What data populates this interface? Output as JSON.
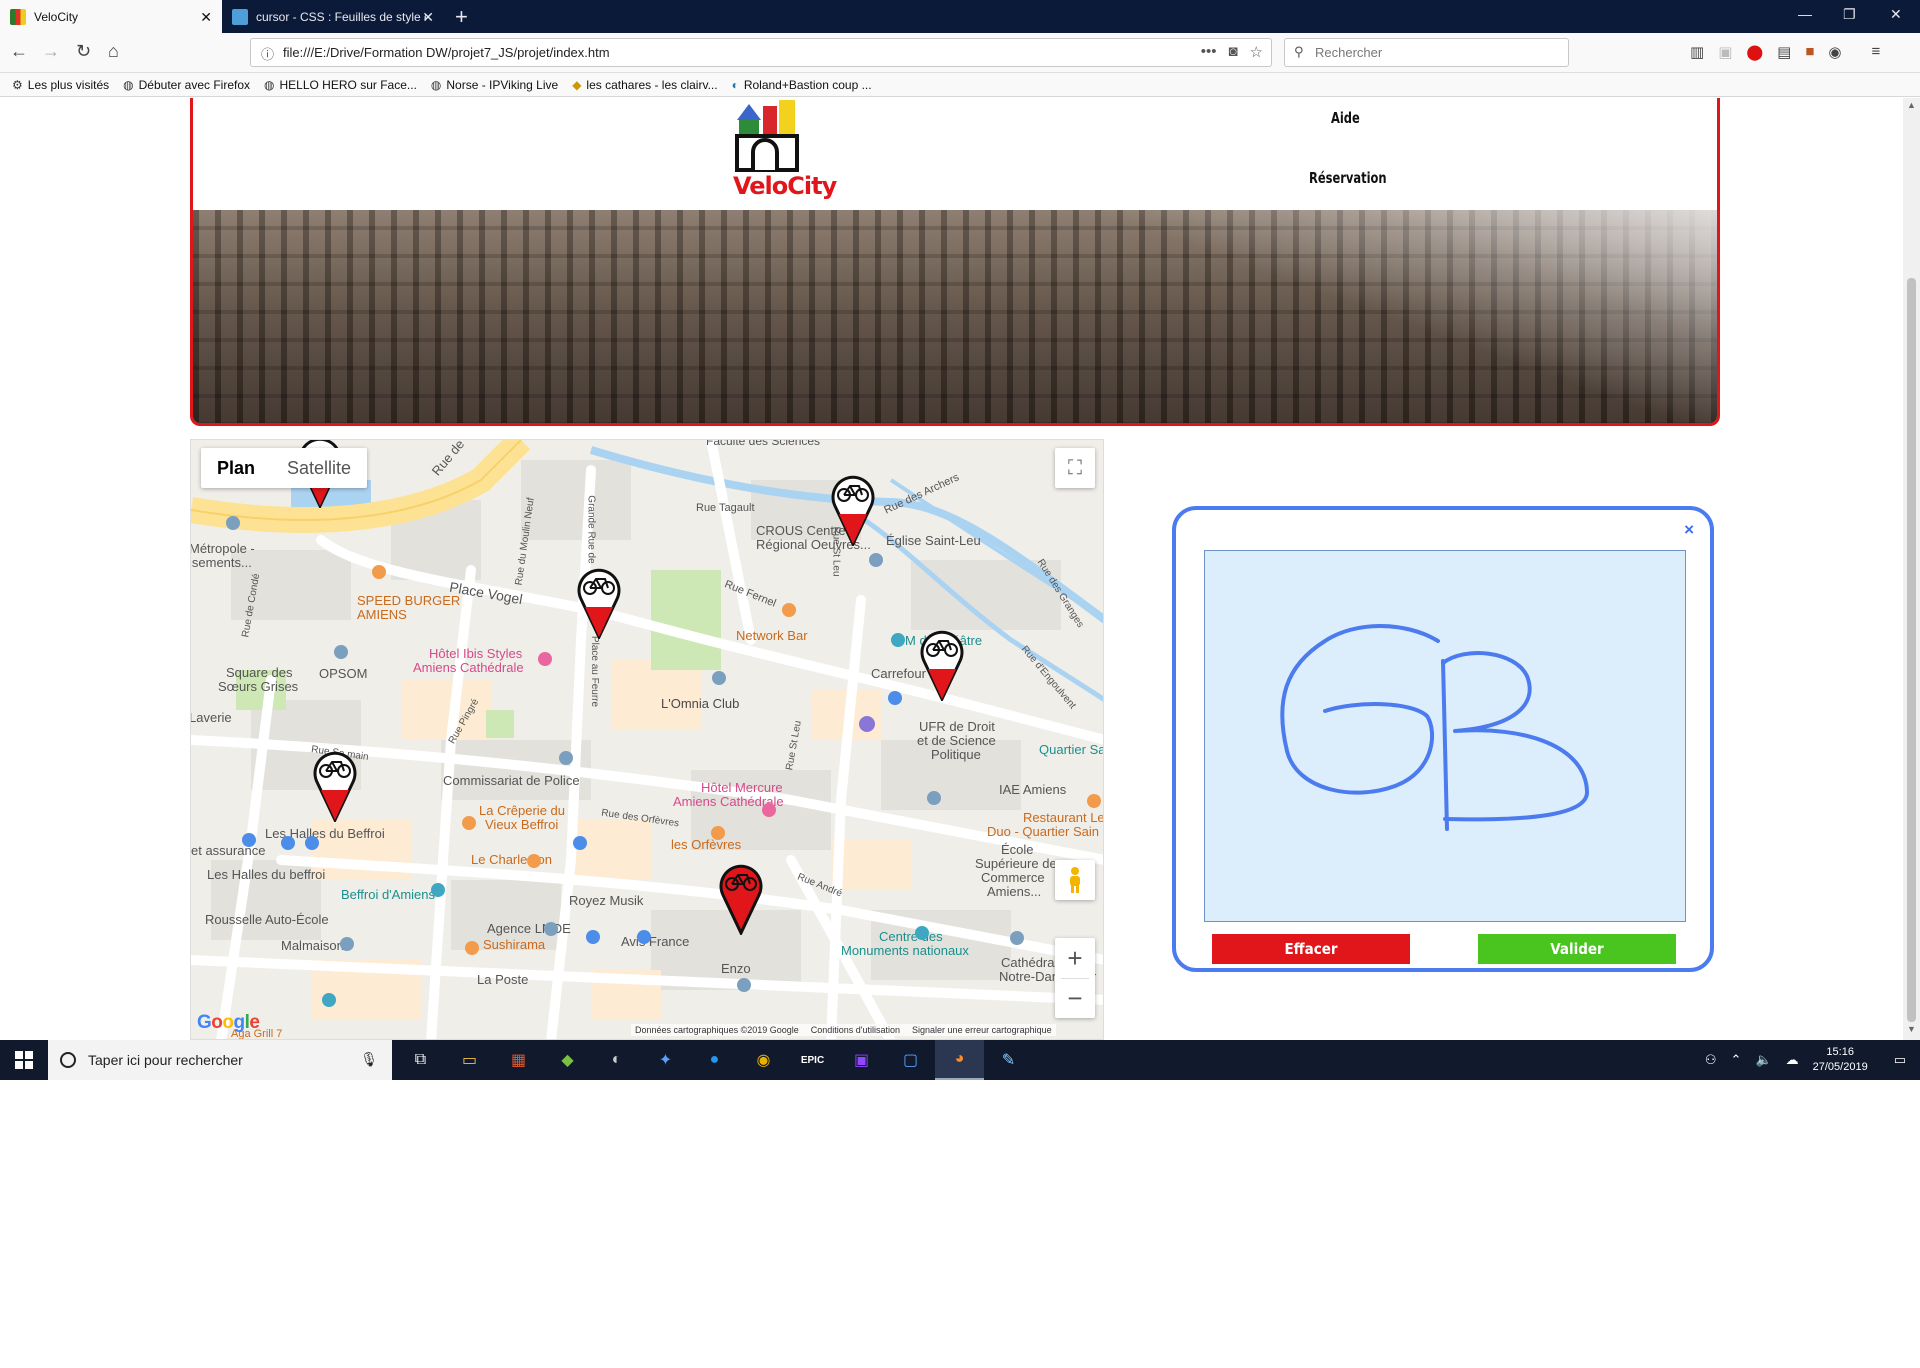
{
  "browser": {
    "tabs": [
      {
        "title": "VeloCity",
        "active": true
      },
      {
        "title": "cursor - CSS : Feuilles de style e",
        "active": false
      }
    ],
    "url": "file:///E:/Drive/Formation DW/projet7_JS/projet/index.htm",
    "search_placeholder": "Rechercher",
    "bookmarks": [
      "Les plus visités",
      "Débuter avec Firefox",
      "HELLO HERO sur Face...",
      "Norse - IPViking Live",
      "les cathares - les clairv...",
      "Roland+Bastion coup ..."
    ]
  },
  "site": {
    "logo_text": "VeloCity",
    "menu": {
      "aide": "Aide",
      "reservation": "Réservation"
    }
  },
  "map": {
    "toggle": {
      "plan": "Plan",
      "satellite": "Satellite"
    },
    "zoom_in": "+",
    "zoom_out": "−",
    "labels": {
      "faculte": "Faculté des Sciences",
      "rue_tagault": "Rue Tagault",
      "rue_archers": "Rue des Archers",
      "crous1": "CROUS Centre",
      "crous2": "Régional Oeuvres...",
      "eglise": "Église Saint-Leu",
      "metropole1": "Métropole -",
      "metropole2": "isements...",
      "place_vogel": "Place Vogel",
      "speed1": "SPEED BURGER",
      "speed2": "AMIENS",
      "rue_fernel": "Rue Fernel",
      "network_bar": "Network Bar",
      "theatre": "M   du Théâtre",
      "ibis1": "Hôtel Ibis Styles",
      "ibis2": "Amiens Cathédrale",
      "carrefour": "Carrefour",
      "square1": "Square des",
      "square2": "Sœurs Grises",
      "opsom": "OPSOM",
      "omnia": "L'Omnia Club",
      "ufr1": "UFR de Droit",
      "ufr2": "et de Science",
      "ufr3": "Politique",
      "quartier": "Quartier Sa",
      "laverie": "Laverie",
      "commissariat": "Commissariat de Police",
      "mercure1": "Hôtel Mercure",
      "mercure2": "Amiens Cathédrale",
      "iae": "IAE Amiens",
      "creperie1": "La Crêperie du",
      "creperie2": "Vieux Beffroi",
      "restaurant1": "Restaurant Le",
      "restaurant2": "Duo - Quartier Sain",
      "halles1": "Les Halles du Beffroi",
      "orfevres_rue": "Rue des Orfèvres",
      "orfevres": "les Orfèvres",
      "ecole1": "École",
      "ecole2": "Supérieure de",
      "ecole3": "Commerce",
      "ecole4": "Amiens...",
      "assurance": "et assurance",
      "charleston": "Le Charleston",
      "halles2": "Les Halles du beffroi",
      "beffroi": "Beffroi d'Amiens",
      "royez": "Royez Musik",
      "rousselle": "Rousselle Auto-École",
      "agence": "Agence LMDE",
      "sushirama": "Sushirama",
      "avis": "Avis France",
      "centre1": "Centre des",
      "centre2": "Monuments nationaux",
      "malmaison": "Malmaison",
      "enzo": "Enzo",
      "cathedrale1": "Cathédra",
      "cathedrale2": "Notre-Dame d'Ar",
      "laposte": "La Poste",
      "rue_andre": "Rue André",
      "rue_stleu": "Rue St Leu",
      "rue_stleu2": "Rue St Leu",
      "place_feurre": "Place au Feurre",
      "grande_rue": "Grande Rue de",
      "moulin": "Rue du Moulin Neuf",
      "conde": "Rue de Condé",
      "pingre": "Rue Pingré",
      "rue_sm": "Rue Sa        main",
      "rue_de": "Rue de",
      "granges": "Rue des Granges",
      "engoulvent": "Rue d'Engoulvent",
      "google": "Google",
      "aga": "Aga Grill 7"
    },
    "attribution": {
      "data": "Données cartographiques ©2019 Google",
      "terms": "Conditions d'utilisation",
      "report": "Signaler une erreur cartographique"
    }
  },
  "signature": {
    "close": "×",
    "clear": "Effacer",
    "validate": "Valider",
    "colors": {
      "border": "#4b7bf0",
      "canvas": "#dcedfb",
      "clear": "#e0161b",
      "validate": "#4ac520"
    }
  },
  "taskbar": {
    "search_placeholder": "Taper ici pour rechercher",
    "time": "15:16",
    "date": "27/05/2019"
  }
}
